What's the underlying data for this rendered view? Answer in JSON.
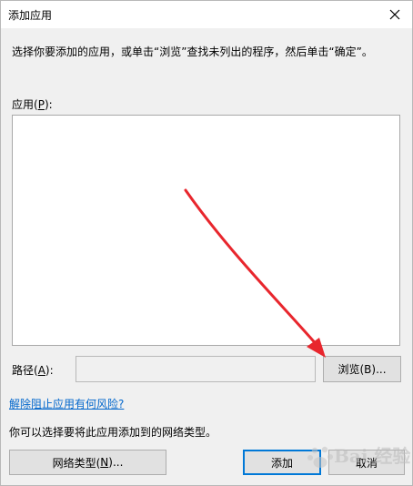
{
  "window": {
    "title": "添加应用"
  },
  "dialog": {
    "instruction": "选择你要添加的应用，或单击“浏览”查找未列出的程序，然后单击“确定”。",
    "app_label_prefix": "应用(",
    "app_label_key": "P",
    "app_label_suffix": "):",
    "path_label_prefix": "路径(",
    "path_label_key": "A",
    "path_label_suffix": "):",
    "path_value": "",
    "browse_label": "浏览(B)...",
    "risk_link": "解除阻止应用有何风险?",
    "network_note": "你可以选择要将此应用添加到的网络类型。",
    "network_btn_prefix": "网络类型(",
    "network_btn_key": "N",
    "network_btn_suffix": ")...",
    "add_label": "添加",
    "cancel_label": "取消"
  },
  "icons": {
    "close": "close-icon"
  },
  "colors": {
    "link": "#0066cc",
    "default_button_border": "#0078d7",
    "annotation_arrow": "#e8262d"
  }
}
